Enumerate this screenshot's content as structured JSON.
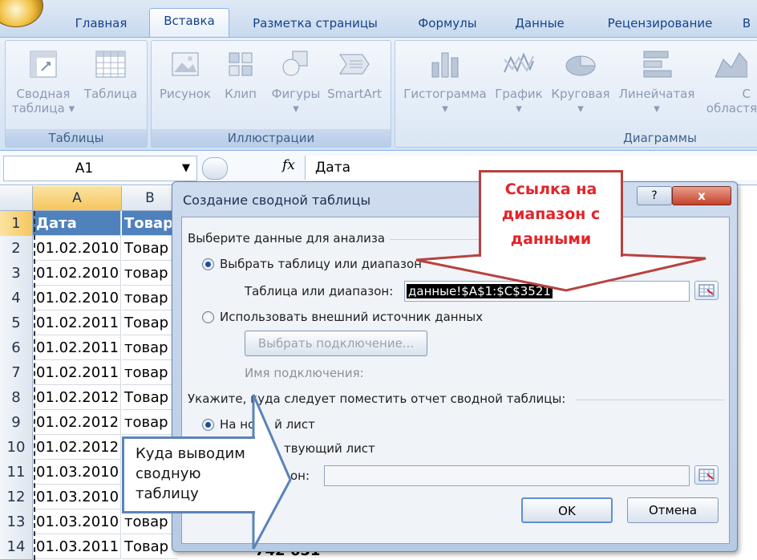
{
  "ribbon": {
    "tabs": [
      "Главная",
      "Вставка",
      "Разметка страницы",
      "Формулы",
      "Данные",
      "Рецензирование",
      "В"
    ],
    "active_tab": "Вставка",
    "groups": {
      "tables": {
        "label": "Таблицы",
        "pivot_line1": "Сводная",
        "pivot_line2": "таблица",
        "table": "Таблица"
      },
      "illustrations": {
        "label": "Иллюстрации",
        "picture": "Рисунок",
        "clip": "Клип",
        "shapes": "Фигуры",
        "smartart": "SmartArt"
      },
      "charts": {
        "label": "Диаграммы",
        "histogram": "Гистограмма",
        "graph": "График",
        "pie": "Круговая",
        "bar": "Линейчатая",
        "area_line1": "С",
        "area_line2": "областя"
      }
    }
  },
  "formula_bar": {
    "cell_ref": "A1",
    "fx": "fx",
    "value": "Дата"
  },
  "sheet": {
    "columns": [
      "A",
      "B"
    ],
    "rows": [
      {
        "n": "1",
        "a": "Дата",
        "b": "Товар"
      },
      {
        "n": "2",
        "a": "01.02.2010",
        "b": "Товар"
      },
      {
        "n": "3",
        "a": "01.02.2010",
        "b": "товар"
      },
      {
        "n": "4",
        "a": "01.02.2010",
        "b": "товар"
      },
      {
        "n": "5",
        "a": "01.02.2011",
        "b": "Товар"
      },
      {
        "n": "6",
        "a": "01.02.2011",
        "b": "товар"
      },
      {
        "n": "7",
        "a": "01.02.2011",
        "b": "товар"
      },
      {
        "n": "8",
        "a": "01.02.2012",
        "b": "Товар"
      },
      {
        "n": "9",
        "a": "01.02.2012",
        "b": "товар"
      },
      {
        "n": "10",
        "a": "01.02.2012",
        "b": "товар"
      },
      {
        "n": "11",
        "a": "01.03.2010",
        "b": "Товар"
      },
      {
        "n": "12",
        "a": "01.03.2010",
        "b": "товар"
      },
      {
        "n": "13",
        "a": "01.03.2010",
        "b": "товар"
      },
      {
        "n": "14",
        "a": "01.03.2011",
        "b": "Товар 1"
      }
    ],
    "row14_value": "742 651"
  },
  "dialog": {
    "title": "Создание сводной таблицы",
    "help": "?",
    "close": "x",
    "section1": "Выберите данные для анализа",
    "opt_table": "Выбрать таблицу или диапазон",
    "range_label": "Таблица или диапазон:",
    "range_value": "данные!$A$1:$C$3521",
    "opt_external": "Использовать внешний источник данных",
    "choose_conn": "Выбрать подключение...",
    "conn_name": "Имя подключения:",
    "section2": "Укажите, куда следует поместить отчет сводной таблицы:",
    "opt_new": "На новый лист",
    "opt_existing": "На существующий лист",
    "opt_existing_visible": "твующий лист",
    "opt_new_visible_a": "На но",
    "opt_new_visible_b": "й лист",
    "location_visible": "он:",
    "ok": "OK",
    "cancel": "Отмена"
  },
  "callouts": {
    "red": [
      "Ссылка на",
      "диапазон с",
      "данными"
    ],
    "blue": [
      "Куда выводим",
      "сводную",
      "таблицу"
    ]
  },
  "colors": {
    "accent_red": "#e3232a",
    "callout_border_red": "#b6423f",
    "callout_border_blue": "#5b83b8",
    "ribbon_text": "#15428b",
    "selection": "#000000"
  }
}
